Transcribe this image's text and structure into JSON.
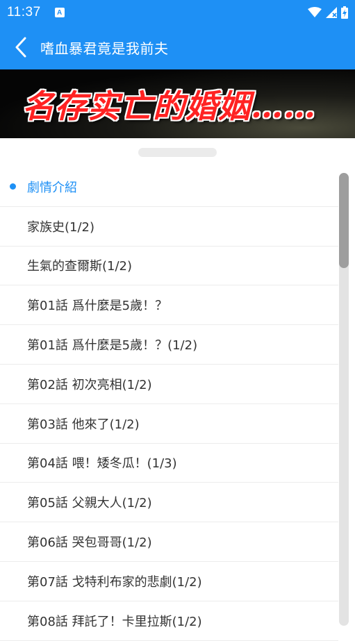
{
  "status_bar": {
    "time": "11:37",
    "notification_icon": "A",
    "icons": [
      "wifi-icon",
      "signal-icon",
      "battery-charging-icon"
    ]
  },
  "app_bar": {
    "title": "嗜血暴君竟是我前夫",
    "back_icon": "chevron-left-icon"
  },
  "banner": {
    "text": "名存实亡的婚姻……"
  },
  "chapters": {
    "items": [
      {
        "label": "劇情介紹",
        "active": true
      },
      {
        "label": "家族史(1/2)",
        "active": false
      },
      {
        "label": "生氣的查爾斯(1/2)",
        "active": false
      },
      {
        "label": "第01話 爲什麼是5歲！？",
        "active": false
      },
      {
        "label": "第01話 爲什麼是5歲！？(1/2)",
        "active": false
      },
      {
        "label": "第02話 初次亮相(1/2)",
        "active": false
      },
      {
        "label": "第03話 他來了(1/2)",
        "active": false
      },
      {
        "label": "第04話 喂！矮冬瓜！(1/3)",
        "active": false
      },
      {
        "label": "第05話 父親大人(1/2)",
        "active": false
      },
      {
        "label": "第06話 哭包哥哥(1/2)",
        "active": false
      },
      {
        "label": "第07話 戈特利布家的悲劇(1/2)",
        "active": false
      },
      {
        "label": "第08話 拜託了！卡里拉斯(1/2)",
        "active": false
      }
    ]
  },
  "colors": {
    "primary": "#1e90f5",
    "text": "#333333",
    "divider": "#ececec",
    "banner_text": "#ff2222"
  }
}
